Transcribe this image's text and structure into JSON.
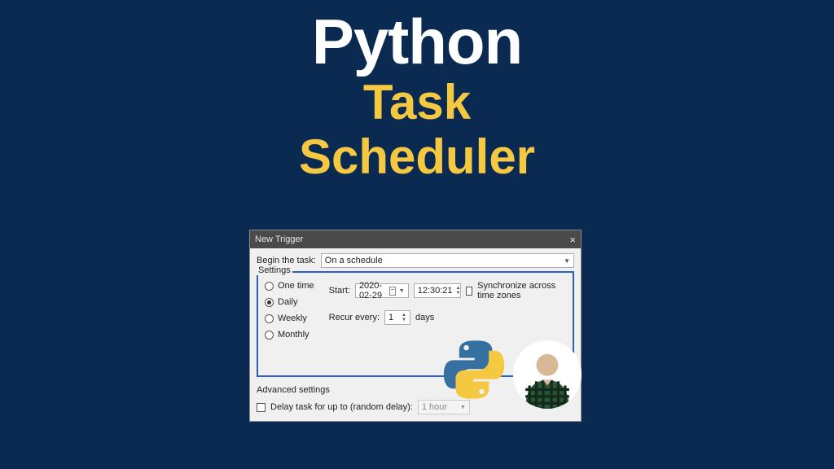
{
  "title": {
    "line1": "Python",
    "line2_a": "Task",
    "line2_b": "Scheduler"
  },
  "dialog": {
    "title": "New Trigger",
    "close": "×",
    "begin_label": "Begin the task:",
    "begin_value": "On a schedule",
    "settings_label": "Settings",
    "radios": {
      "one_time": "One time",
      "daily": "Daily",
      "weekly": "Weekly",
      "monthly": "Monthly"
    },
    "start_label": "Start:",
    "start_date": "2020-02-29",
    "start_time": "12:30:21",
    "sync_label": "Synchronize across time zones",
    "recur_label": "Recur every:",
    "recur_value": "1",
    "recur_unit": "days",
    "advanced_label": "Advanced settings",
    "delay_label": "Delay task for up to (random delay):",
    "delay_value": "1 hour"
  }
}
